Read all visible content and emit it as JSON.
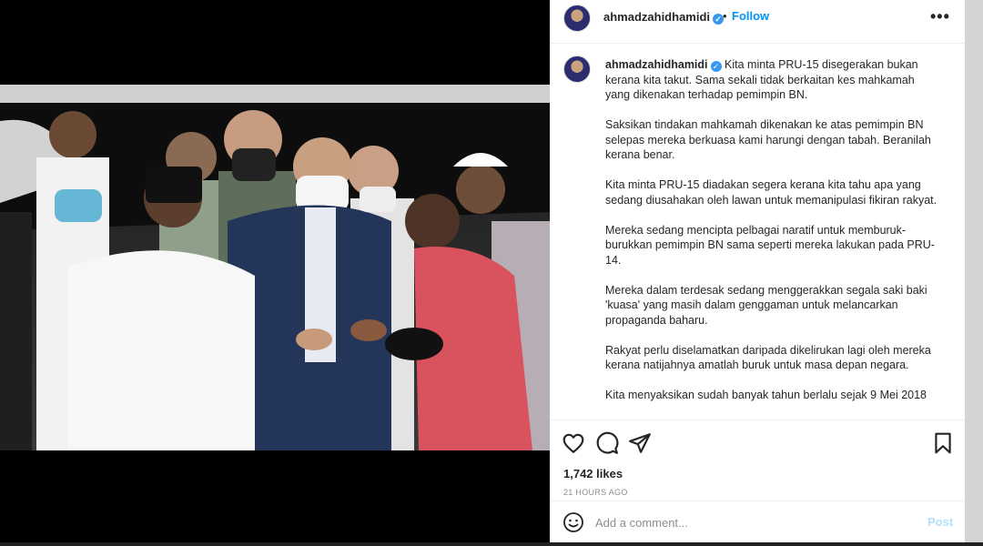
{
  "post": {
    "username": "ahmadzahidhamidi",
    "follow_label": "Follow",
    "separator": "•",
    "more_label": "•••",
    "photo_alt": "ahmadzahidhamidi post photo"
  },
  "caption": {
    "username": "ahmadzahidhamidi",
    "paragraphs": [
      "Kita minta PRU-15 disegerakan bukan kerana kita takut. Sama sekali tidak berkaitan kes mahkamah yang dikenakan terhadap pemimpin BN.",
      "Saksikan tindakan mahkamah dikenakan ke atas pemimpin BN selepas mereka berkuasa kami harungi dengan tabah. Beranilah kerana benar.",
      "Kita minta PRU-15 diadakan segera kerana kita tahu apa yang sedang diusahakan oleh lawan untuk memanipulasi fikiran rakyat.",
      "Mereka sedang mencipta pelbagai naratif untuk memburuk-burukkan pemimpin BN sama seperti mereka lakukan pada PRU-14.",
      "Mereka dalam terdesak sedang menggerakkan segala saki baki 'kuasa' yang masih dalam genggaman untuk melancarkan propaganda baharu.",
      "Rakyat perlu diselamatkan daripada dikelirukan lagi oleh mereka kerana natijahnya amatlah buruk untuk masa depan negara.",
      "Kita menyaksikan sudah banyak tahun berlalu sejak 9 Mei 2018"
    ]
  },
  "stats": {
    "likes": "1,742 likes",
    "timestamp": "21 HOURS AGO"
  },
  "comment": {
    "placeholder": "Add a comment...",
    "post_label": "Post"
  },
  "icons": {
    "like": "heart-icon",
    "comment": "comment-icon",
    "share": "share-icon",
    "save": "bookmark-icon",
    "emoji": "emoji-icon",
    "verified": "verified-badge-icon"
  },
  "colors": {
    "accent": "#0095f6",
    "verified": "#3897f0",
    "post_disabled": "#b2dffc",
    "muted_text": "#8e8e8e"
  }
}
